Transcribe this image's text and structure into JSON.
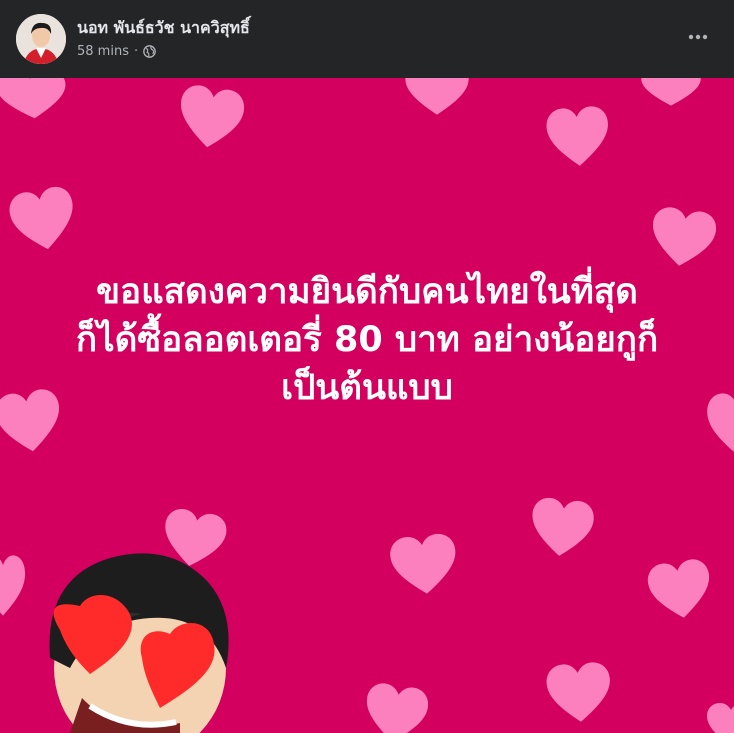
{
  "post": {
    "author": "นอท พันธ์ธวัช นาควิสุทธิ์",
    "time": "58 mins",
    "separator": "·",
    "privacy_icon": "globe-icon",
    "more_icon": "more-options-icon",
    "message_lines": [
      "ขอแสดงความยินดีกับคนไทยในที่สุด",
      "ก็ได้ซื้อลอตเตอรี่ 80 บาท อย่างน้อยกูก็",
      "เป็นต้นแบบ"
    ]
  },
  "colors": {
    "background": "#d4005f",
    "heart_fill": "#ff8cc6",
    "header_bg": "#242526",
    "author_text": "#e4e6eb",
    "meta_text": "#b0b3b8",
    "message_text": "#ffffff"
  }
}
